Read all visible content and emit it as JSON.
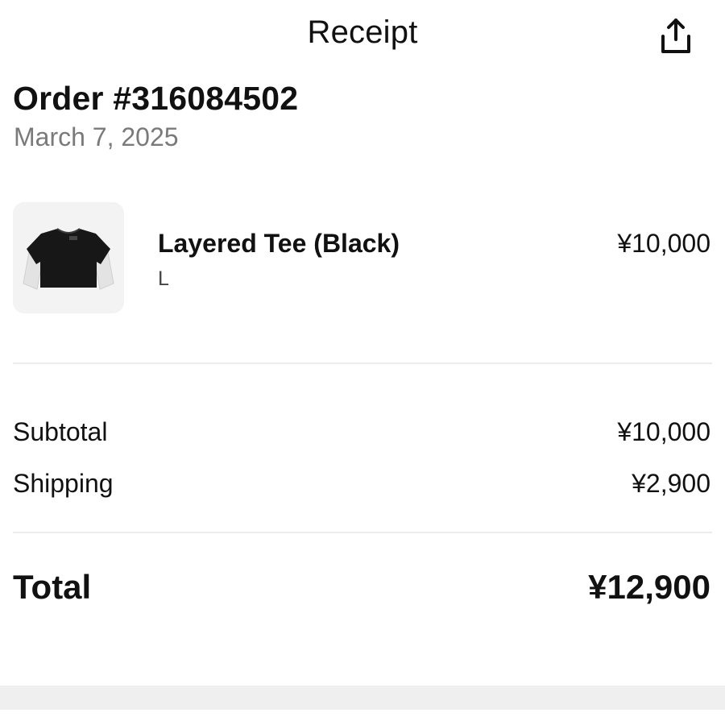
{
  "header": {
    "title": "Receipt",
    "share_icon": "share-upload-icon"
  },
  "order": {
    "title": "Order #316084502",
    "date": "March 7, 2025"
  },
  "item": {
    "name": "Layered Tee (Black)",
    "variant": "L",
    "price": "¥10,000",
    "image_icon": "layered-tee-black-thumbnail"
  },
  "summary": {
    "subtotal_label": "Subtotal",
    "subtotal_value": "¥10,000",
    "shipping_label": "Shipping",
    "shipping_value": "¥2,900",
    "total_label": "Total",
    "total_value": "¥12,900"
  },
  "colors": {
    "text": "#111111",
    "muted_text": "#7a7a7a",
    "divider": "#ececec",
    "thumb_bg": "#f3f3f3"
  }
}
